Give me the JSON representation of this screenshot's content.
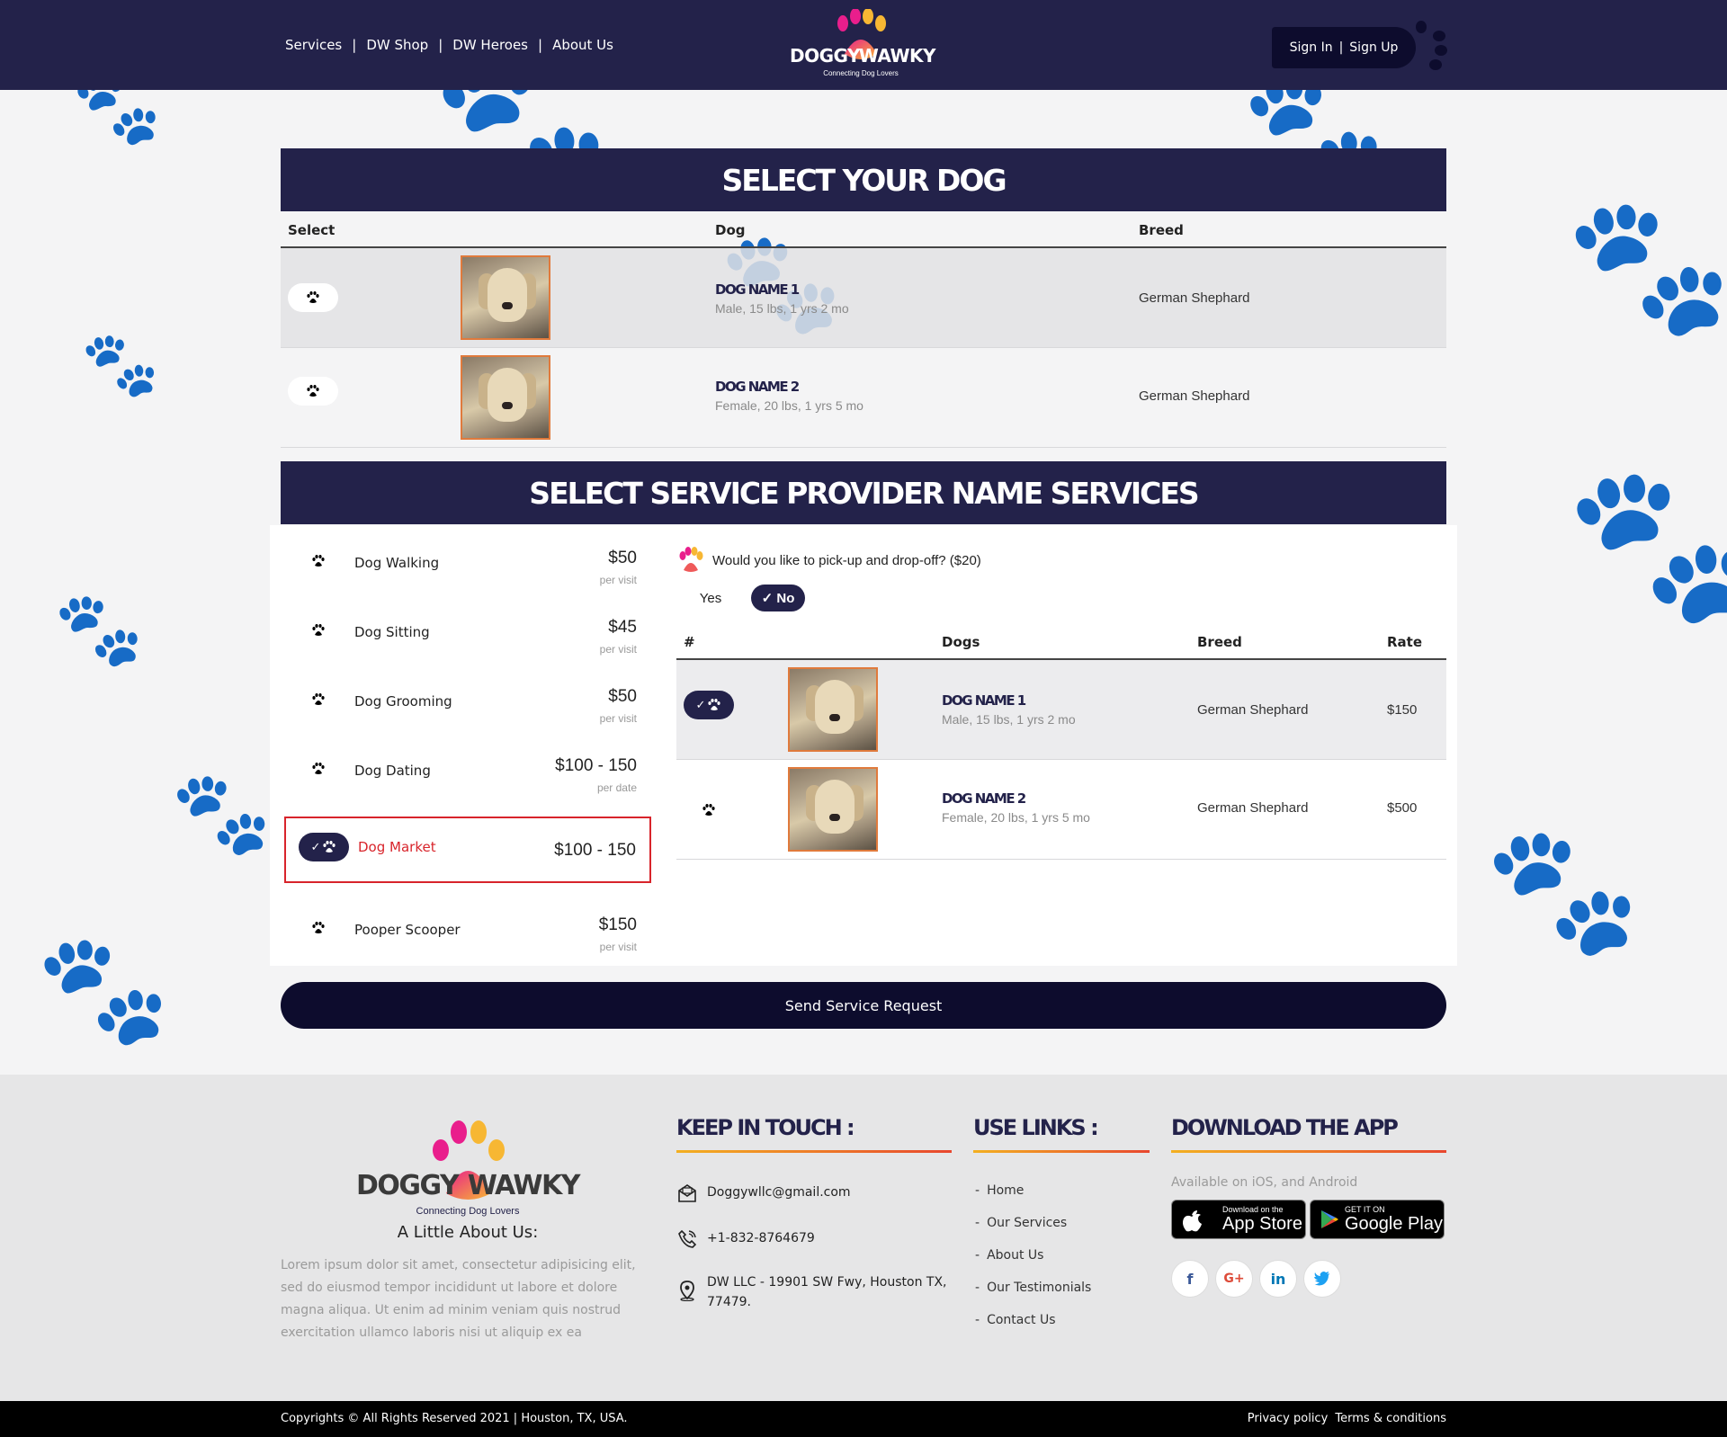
{
  "header": {
    "nav": [
      "Services",
      "DW Shop",
      "DW Heroes",
      "About Us"
    ],
    "separator": "|",
    "logo_left": "DOGGY",
    "logo_right": "WAWKY",
    "logo_tagline": "Connecting Dog Lovers",
    "sign_in": "Sign In",
    "sign_up": "Sign Up"
  },
  "select_dog": {
    "title": "SELECT YOUR DOG",
    "columns": [
      "Select",
      "Dog",
      "Breed"
    ],
    "rows": [
      {
        "name": "DOG NAME 1",
        "meta": "Male, 15 lbs, 1 yrs 2 mo",
        "breed": "German Shephard"
      },
      {
        "name": "DOG NAME 2",
        "meta": "Female, 20 lbs, 1 yrs 5 mo",
        "breed": "German Shephard"
      }
    ]
  },
  "services": {
    "title": "SELECT SERVICE PROVIDER NAME SERVICES",
    "items": [
      {
        "name": "Dog Walking",
        "price": "$50",
        "unit": "per visit"
      },
      {
        "name": "Dog Sitting",
        "price": "$45",
        "unit": "per visit"
      },
      {
        "name": "Dog Grooming",
        "price": "$50",
        "unit": "per visit"
      },
      {
        "name": "Dog Dating",
        "price": "$100 - 150",
        "unit": "per date"
      },
      {
        "name": "Dog Market",
        "price": "$100 - 150",
        "unit": ""
      },
      {
        "name": "Pooper Scooper",
        "price": "$150",
        "unit": "per visit"
      }
    ],
    "selected_service": "Dog Market",
    "pickup_question": "Would you like to pick-up and drop-off? ($20)",
    "yes_label": "Yes",
    "no_label": "✓ No",
    "pickup_selected": "No",
    "table_columns": [
      "#",
      "Dogs",
      "Breed",
      "Rate"
    ],
    "table_rows": [
      {
        "name": "DOG NAME 1",
        "meta": "Male, 15 lbs, 1 yrs 2 mo",
        "breed": "German Shephard",
        "rate": "$150",
        "selected": true
      },
      {
        "name": "DOG NAME 2",
        "meta": "Female, 20 lbs, 1 yrs 5 mo",
        "breed": "German Shephard",
        "rate": "$500",
        "selected": false
      }
    ],
    "send_button": "Send Service Request"
  },
  "footer": {
    "logo_left": "DOGGY",
    "logo_right": "WAWKY",
    "logo_tagline": "Connecting Dog Lovers",
    "about_title": "A Little About Us:",
    "about_text": "Lorem ipsum dolor sit amet, consectetur adipisicing elit, sed do eiusmod tempor incididunt ut labore et dolore magna aliqua. Ut enim ad minim veniam quis nostrud exercitation ullamco laboris nisi ut aliquip ex ea",
    "keep_in_touch_title": "KEEP IN TOUCH :",
    "email": "Doggywllc@gmail.com",
    "phone": "+1-832-8764679",
    "address": "DW LLC - 19901 SW Fwy, Houston TX, 77479.",
    "use_links_title": "USE LINKS :",
    "links": [
      "Home",
      "Our Services",
      "About Us",
      "Our Testimonials",
      "Contact Us"
    ],
    "app_title": "DOWNLOAD THE APP",
    "app_availability": "Available on iOS, and Android",
    "app_store_small": "Download on the",
    "app_store_big": "App Store",
    "play_store_small": "GET IT ON",
    "play_store_big": "Google Play",
    "social": [
      {
        "icon": "facebook-icon",
        "glyph": "f",
        "color": "#3b5998"
      },
      {
        "icon": "google-plus-icon",
        "glyph": "G+",
        "color": "#dd4b39"
      },
      {
        "icon": "linkedin-icon",
        "glyph": "in",
        "color": "#0077b5"
      },
      {
        "icon": "twitter-icon",
        "glyph": "🐦",
        "color": "#1da1f2"
      }
    ],
    "copyright": "Copyrights © All Rights Reserved 2021 | Houston, TX, USA.",
    "privacy": "Privacy policy",
    "terms": "Terms & conditions"
  },
  "colors": {
    "navy": "#23224a",
    "dark_navy": "#0d0c2d",
    "accent_red": "#d8242b",
    "gradient_start": "#f3b021",
    "gradient_end": "#e8472e"
  }
}
